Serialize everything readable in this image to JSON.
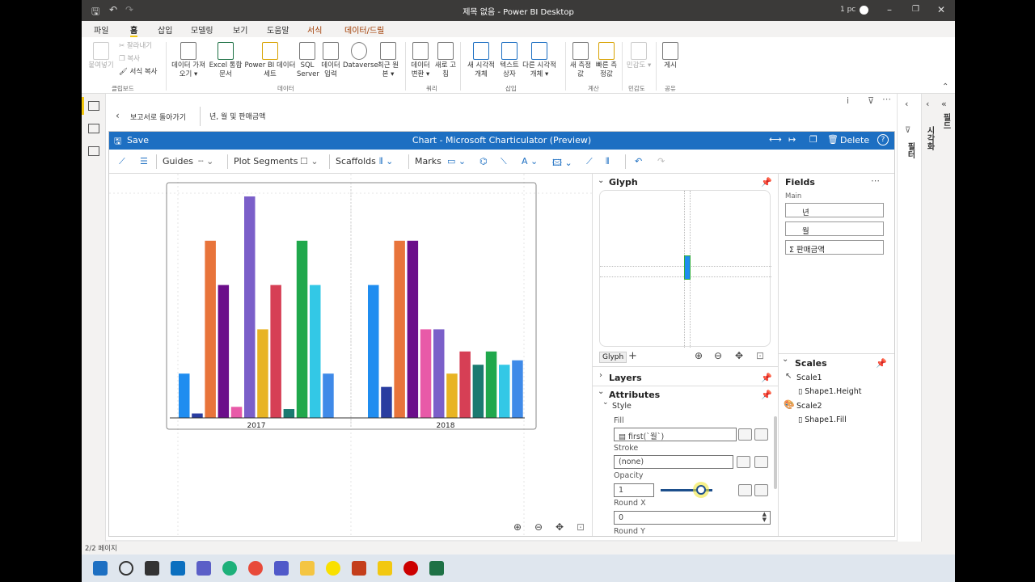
{
  "window": {
    "title": "제목 없음 - Power BI Desktop",
    "user": "1 pc"
  },
  "menu_tabs": [
    {
      "label": "파일"
    },
    {
      "label": "홈"
    },
    {
      "label": "삽입"
    },
    {
      "label": "모델링"
    },
    {
      "label": "보기"
    },
    {
      "label": "도움말"
    },
    {
      "label": "서식"
    },
    {
      "label": "데이터/드릴"
    }
  ],
  "ribbon": {
    "clipboard": {
      "paste": "붙여넣기",
      "cut": "잘라내기",
      "copy": "복사",
      "format_copy": "서식 복사",
      "group": "클립보드"
    },
    "data": {
      "get_data": "데이터 가져오기",
      "excel": "Excel 통합 문서",
      "pbi_dataset": "Power BI 데이터 세트",
      "sql": "SQL Server",
      "enter_data": "데이터 입력",
      "dataverse": "Dataverse",
      "recent": "최근 원본",
      "group": "데이터"
    },
    "query": {
      "transform": "데이터 변환",
      "refresh": "새로 고침",
      "group": "쿼리"
    },
    "insert": {
      "new_visual": "새 시각적 개체",
      "text_box": "텍스트 상자",
      "more_visuals": "다른 시각적 개체",
      "group": "삽입"
    },
    "calc": {
      "new_measure": "새 측정값",
      "quick_measure": "빠른 측정값",
      "group": "계산"
    },
    "sensitivity": {
      "label": "민감도",
      "group": "민감도"
    },
    "share": {
      "publish": "게시",
      "group": "공유"
    }
  },
  "backbar": {
    "back_label": "보고서로 돌아가기",
    "fields_label": "년, 월 및 판매금액"
  },
  "charticulator": {
    "save": "Save",
    "title": "Chart - Microsoft Charticulator (Preview)",
    "delete": "Delete",
    "toolbar": {
      "guides": "Guides",
      "plot_segments": "Plot Segments",
      "scaffolds": "Scaffolds",
      "marks": "Marks"
    },
    "glyph_panel": {
      "title": "Glyph",
      "tab": "Glyph",
      "layers": "Layers",
      "attributes": "Attributes",
      "style": "Style",
      "fill_label": "Fill",
      "fill_value": "first(`월`)",
      "stroke_label": "Stroke",
      "stroke_value": "(none)",
      "opacity_label": "Opacity",
      "opacity_value": "1",
      "opacity": 1,
      "round_x_label": "Round X",
      "round_x_value": "0",
      "round_y_label": "Round Y"
    },
    "fields_panel": {
      "title": "Fields",
      "group": "Main",
      "fields": [
        "년",
        "월",
        "판매금액"
      ],
      "scales_title": "Scales",
      "scales": [
        {
          "name": "Scale1",
          "target": "Shape1.Height"
        },
        {
          "name": "Scale2",
          "target": "Shape1.Fill"
        }
      ]
    }
  },
  "right_panes": {
    "filters": "필터",
    "visualizations": "시각화",
    "fields": "필드"
  },
  "status": {
    "pages": "2/2 페이지"
  },
  "colors": {
    "accent": "#1d6fc2",
    "titlebar": "#3b3a39"
  },
  "chart_data": {
    "type": "bar",
    "categories": [
      "2017",
      "2018"
    ],
    "series_colors": [
      "#1f8df0",
      "#2a3da0",
      "#e8743b",
      "#6b0e8a",
      "#e85aa8",
      "#7b5fc9",
      "#e8b423",
      "#d63f55",
      "#1a7a70",
      "#20a84c",
      "#33c8e6",
      "#3f8ae8"
    ],
    "groups": [
      {
        "label": "2017",
        "values": [
          10,
          1,
          40,
          30,
          2.5,
          50,
          20,
          30,
          2,
          40,
          30,
          10
        ]
      },
      {
        "label": "2018",
        "values": [
          30,
          7,
          40,
          40,
          20,
          20,
          10,
          15,
          12,
          15,
          12,
          13
        ]
      }
    ],
    "ylim": [
      0,
      50
    ]
  }
}
